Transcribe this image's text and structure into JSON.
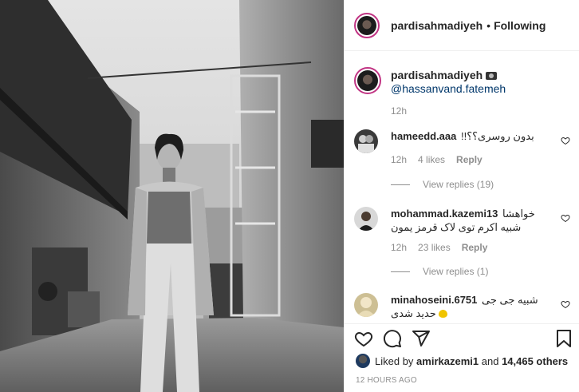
{
  "post": {
    "username": "pardisahmadiyeh",
    "follow_status": "Following",
    "caption": {
      "username": "pardisahmadiyeh",
      "camera_icon": "camera-icon",
      "mention": "@hassanvand.fatemeh",
      "time": "12h"
    },
    "comments": [
      {
        "username": "hameedd.aaa",
        "text": "بدون روسری؟؟!!",
        "time": "12h",
        "likes": "4 likes",
        "reply": "Reply",
        "view_replies": "View replies (19)"
      },
      {
        "username": "mohammad.kazemi13",
        "text": "خواهشا شبیه اکرم توی لاک قرمز یمون",
        "time": "12h",
        "likes": "23 likes",
        "reply": "Reply",
        "view_replies": "View replies (1)"
      },
      {
        "username": "minahoseini.6751",
        "text": "شبیه جی جی حدید شدی",
        "time": "",
        "likes": "",
        "reply": ""
      }
    ],
    "liked_by": {
      "prefix": "Liked by",
      "user": "amirkazemi1",
      "and": "and",
      "others": "14,465 others"
    },
    "time_ago": "12 HOURS AGO",
    "icons": [
      "heart-icon",
      "comment-icon",
      "share-icon",
      "save-icon"
    ]
  }
}
